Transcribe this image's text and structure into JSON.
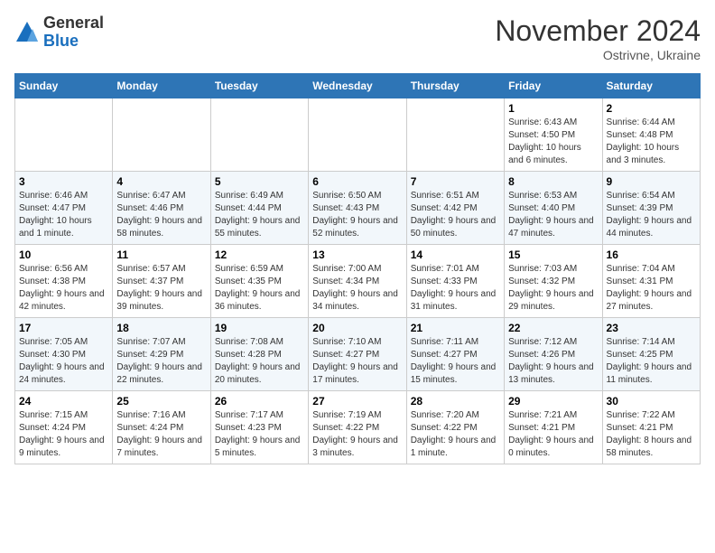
{
  "header": {
    "logo_general": "General",
    "logo_blue": "Blue",
    "month_title": "November 2024",
    "location": "Ostrivne, Ukraine"
  },
  "weekdays": [
    "Sunday",
    "Monday",
    "Tuesday",
    "Wednesday",
    "Thursday",
    "Friday",
    "Saturday"
  ],
  "weeks": [
    [
      {
        "day": "",
        "info": ""
      },
      {
        "day": "",
        "info": ""
      },
      {
        "day": "",
        "info": ""
      },
      {
        "day": "",
        "info": ""
      },
      {
        "day": "",
        "info": ""
      },
      {
        "day": "1",
        "info": "Sunrise: 6:43 AM\nSunset: 4:50 PM\nDaylight: 10 hours and 6 minutes."
      },
      {
        "day": "2",
        "info": "Sunrise: 6:44 AM\nSunset: 4:48 PM\nDaylight: 10 hours and 3 minutes."
      }
    ],
    [
      {
        "day": "3",
        "info": "Sunrise: 6:46 AM\nSunset: 4:47 PM\nDaylight: 10 hours and 1 minute."
      },
      {
        "day": "4",
        "info": "Sunrise: 6:47 AM\nSunset: 4:46 PM\nDaylight: 9 hours and 58 minutes."
      },
      {
        "day": "5",
        "info": "Sunrise: 6:49 AM\nSunset: 4:44 PM\nDaylight: 9 hours and 55 minutes."
      },
      {
        "day": "6",
        "info": "Sunrise: 6:50 AM\nSunset: 4:43 PM\nDaylight: 9 hours and 52 minutes."
      },
      {
        "day": "7",
        "info": "Sunrise: 6:51 AM\nSunset: 4:42 PM\nDaylight: 9 hours and 50 minutes."
      },
      {
        "day": "8",
        "info": "Sunrise: 6:53 AM\nSunset: 4:40 PM\nDaylight: 9 hours and 47 minutes."
      },
      {
        "day": "9",
        "info": "Sunrise: 6:54 AM\nSunset: 4:39 PM\nDaylight: 9 hours and 44 minutes."
      }
    ],
    [
      {
        "day": "10",
        "info": "Sunrise: 6:56 AM\nSunset: 4:38 PM\nDaylight: 9 hours and 42 minutes."
      },
      {
        "day": "11",
        "info": "Sunrise: 6:57 AM\nSunset: 4:37 PM\nDaylight: 9 hours and 39 minutes."
      },
      {
        "day": "12",
        "info": "Sunrise: 6:59 AM\nSunset: 4:35 PM\nDaylight: 9 hours and 36 minutes."
      },
      {
        "day": "13",
        "info": "Sunrise: 7:00 AM\nSunset: 4:34 PM\nDaylight: 9 hours and 34 minutes."
      },
      {
        "day": "14",
        "info": "Sunrise: 7:01 AM\nSunset: 4:33 PM\nDaylight: 9 hours and 31 minutes."
      },
      {
        "day": "15",
        "info": "Sunrise: 7:03 AM\nSunset: 4:32 PM\nDaylight: 9 hours and 29 minutes."
      },
      {
        "day": "16",
        "info": "Sunrise: 7:04 AM\nSunset: 4:31 PM\nDaylight: 9 hours and 27 minutes."
      }
    ],
    [
      {
        "day": "17",
        "info": "Sunrise: 7:05 AM\nSunset: 4:30 PM\nDaylight: 9 hours and 24 minutes."
      },
      {
        "day": "18",
        "info": "Sunrise: 7:07 AM\nSunset: 4:29 PM\nDaylight: 9 hours and 22 minutes."
      },
      {
        "day": "19",
        "info": "Sunrise: 7:08 AM\nSunset: 4:28 PM\nDaylight: 9 hours and 20 minutes."
      },
      {
        "day": "20",
        "info": "Sunrise: 7:10 AM\nSunset: 4:27 PM\nDaylight: 9 hours and 17 minutes."
      },
      {
        "day": "21",
        "info": "Sunrise: 7:11 AM\nSunset: 4:27 PM\nDaylight: 9 hours and 15 minutes."
      },
      {
        "day": "22",
        "info": "Sunrise: 7:12 AM\nSunset: 4:26 PM\nDaylight: 9 hours and 13 minutes."
      },
      {
        "day": "23",
        "info": "Sunrise: 7:14 AM\nSunset: 4:25 PM\nDaylight: 9 hours and 11 minutes."
      }
    ],
    [
      {
        "day": "24",
        "info": "Sunrise: 7:15 AM\nSunset: 4:24 PM\nDaylight: 9 hours and 9 minutes."
      },
      {
        "day": "25",
        "info": "Sunrise: 7:16 AM\nSunset: 4:24 PM\nDaylight: 9 hours and 7 minutes."
      },
      {
        "day": "26",
        "info": "Sunrise: 7:17 AM\nSunset: 4:23 PM\nDaylight: 9 hours and 5 minutes."
      },
      {
        "day": "27",
        "info": "Sunrise: 7:19 AM\nSunset: 4:22 PM\nDaylight: 9 hours and 3 minutes."
      },
      {
        "day": "28",
        "info": "Sunrise: 7:20 AM\nSunset: 4:22 PM\nDaylight: 9 hours and 1 minute."
      },
      {
        "day": "29",
        "info": "Sunrise: 7:21 AM\nSunset: 4:21 PM\nDaylight: 9 hours and 0 minutes."
      },
      {
        "day": "30",
        "info": "Sunrise: 7:22 AM\nSunset: 4:21 PM\nDaylight: 8 hours and 58 minutes."
      }
    ]
  ]
}
